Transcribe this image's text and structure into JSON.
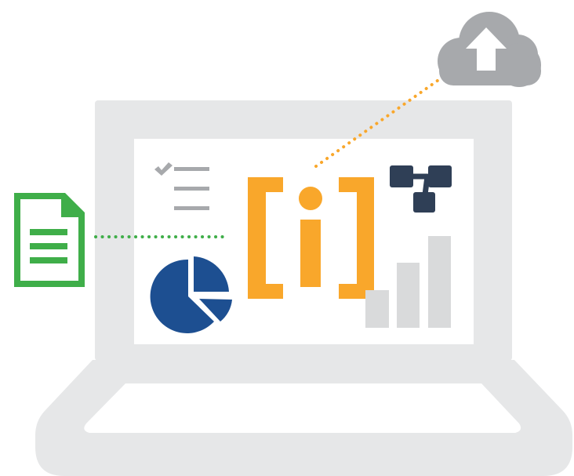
{
  "illustration": {
    "icons": [
      "laptop-icon",
      "cloud-upload-icon",
      "checklist-icon",
      "info-brackets-icon",
      "workflow-icon",
      "pie-chart-icon",
      "bar-chart-icon",
      "document-icon"
    ],
    "colors": {
      "laptop": "#e6e7e8",
      "screen": "#ffffff",
      "cloud": "#a7a9ac",
      "info_accent": "#f9a72b",
      "document": "#3fae49",
      "pie": "#1d4f91",
      "workflow": "#2f3f56",
      "checklist": "#a7a9ac",
      "bars": "#d9dadb"
    }
  }
}
